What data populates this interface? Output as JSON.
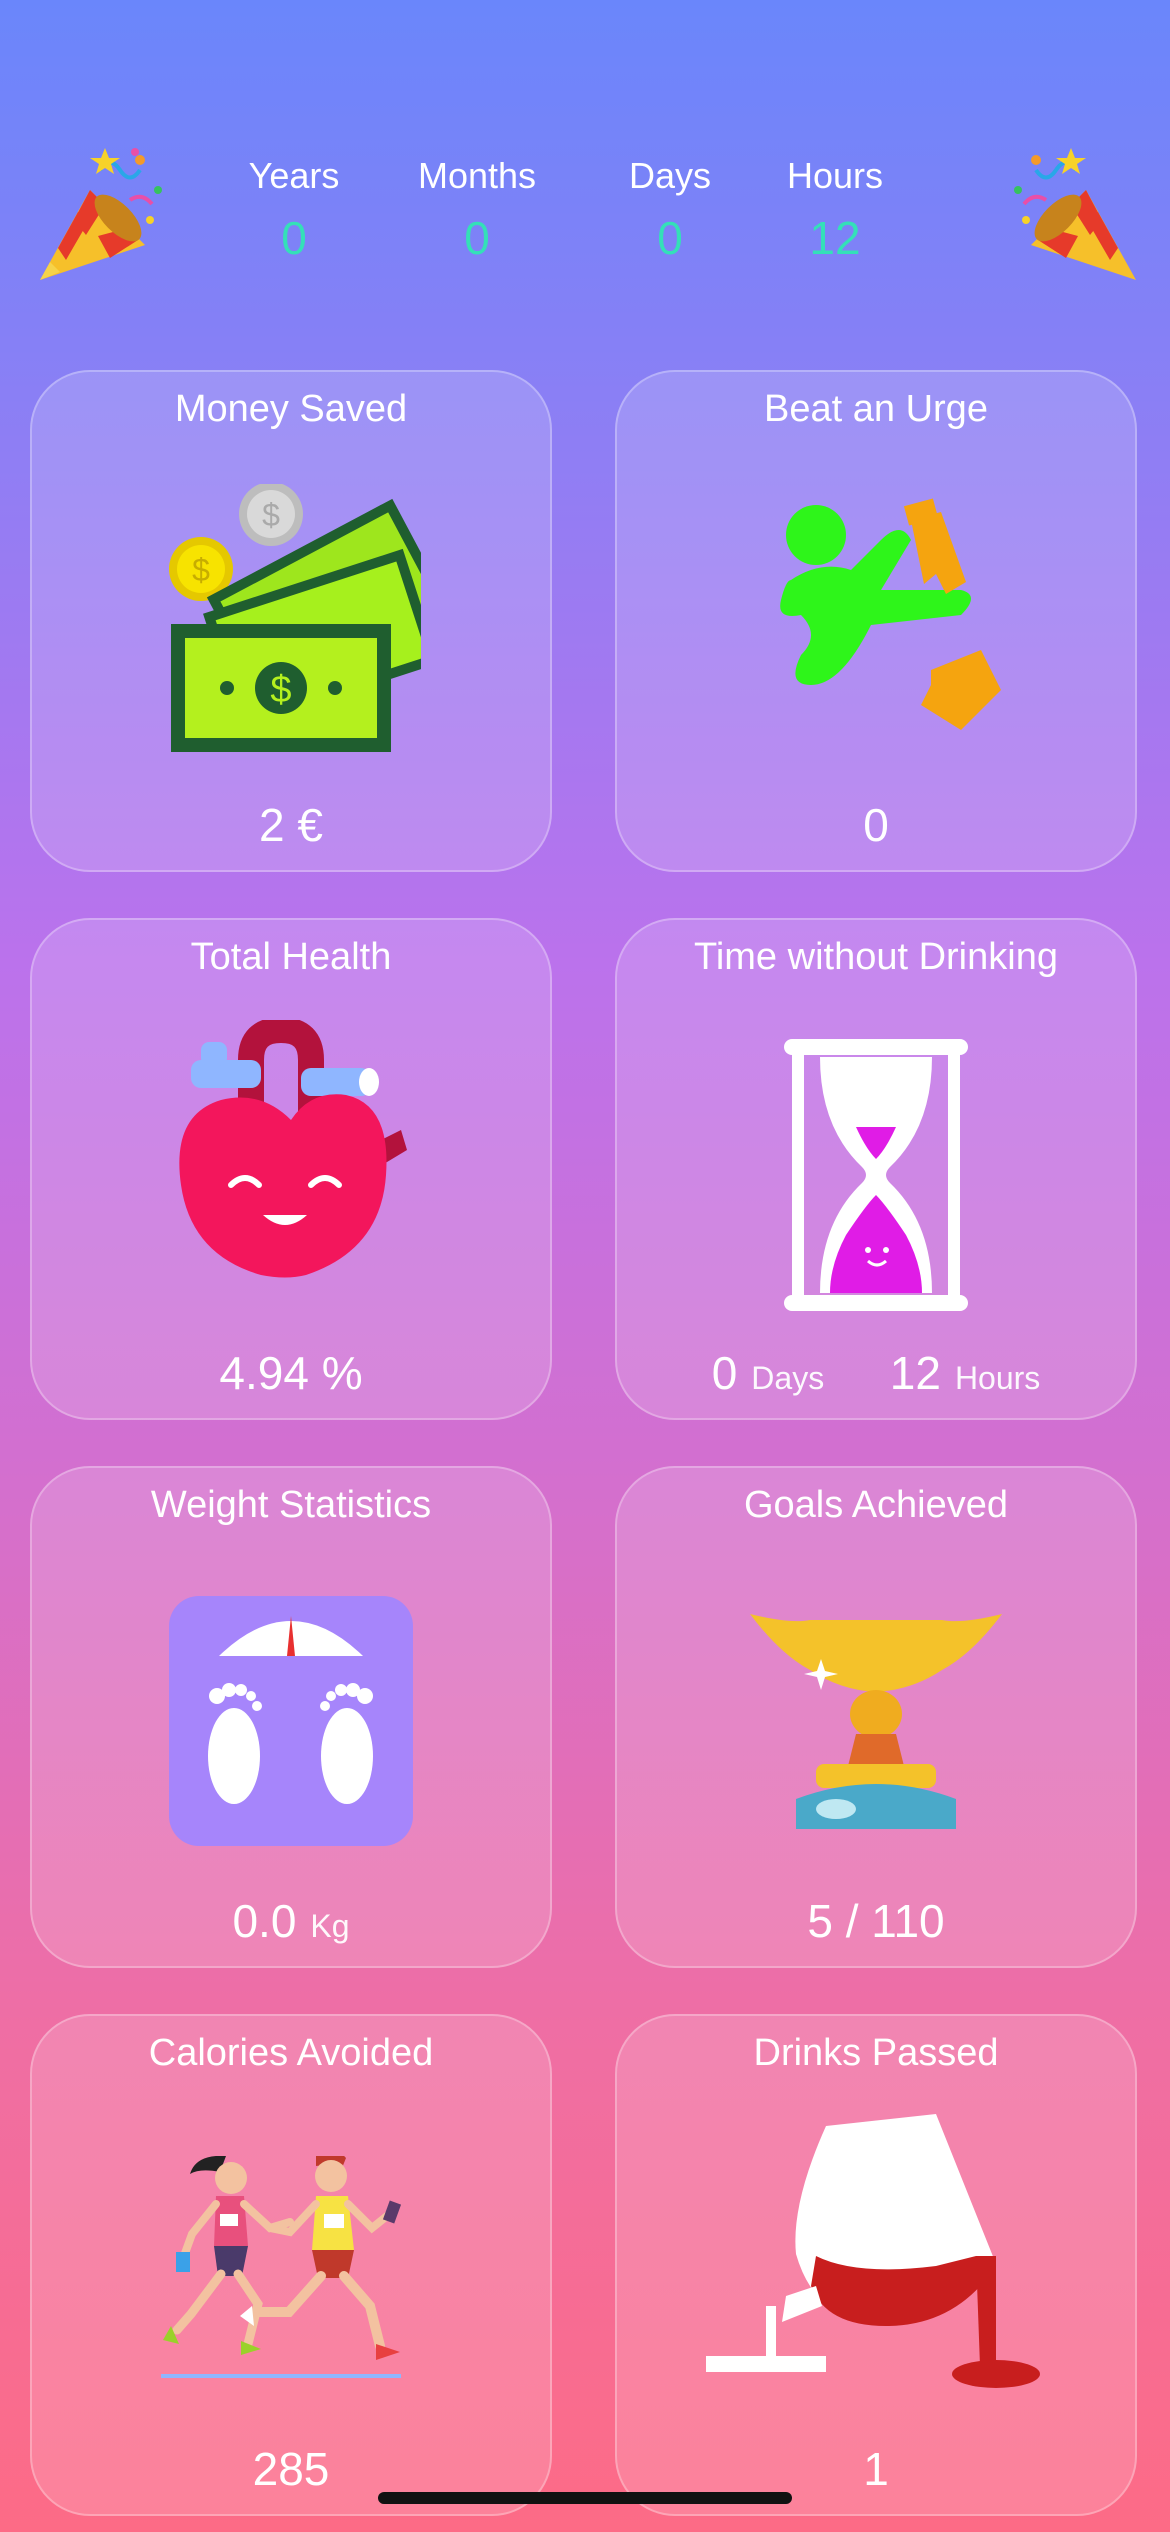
{
  "timer": {
    "columns": [
      {
        "label": "Years",
        "value": "0"
      },
      {
        "label": "Months",
        "value": "0"
      },
      {
        "label": "Days",
        "value": "0"
      },
      {
        "label": "Hours",
        "value": "12"
      }
    ]
  },
  "cards": {
    "money": {
      "title": "Money Saved",
      "value": "2 €",
      "icon": "money-stack-icon"
    },
    "urge": {
      "title": "Beat an Urge",
      "value": "0",
      "icon": "karate-kick-bottle-icon"
    },
    "health": {
      "title": "Total Health",
      "value": "4.94 %",
      "icon": "happy-heart-icon"
    },
    "time": {
      "title": "Time without Drinking",
      "days_value": "0",
      "days_unit": "Days",
      "hours_value": "12",
      "hours_unit": "Hours",
      "icon": "hourglass-icon"
    },
    "weight": {
      "title": "Weight Statistics",
      "value": "0.0",
      "unit": "Kg",
      "icon": "bathroom-scale-icon"
    },
    "goals": {
      "title": "Goals Achieved",
      "value": "5 / 110",
      "icon": "trophy-icon"
    },
    "calories": {
      "title": "Calories Avoided",
      "value": "285",
      "icon": "runners-icon"
    },
    "drinks": {
      "title": "Drinks Passed",
      "value": "1",
      "icon": "spilled-wine-glass-icon"
    }
  },
  "colors": {
    "timer_value": "#34e0b8"
  }
}
